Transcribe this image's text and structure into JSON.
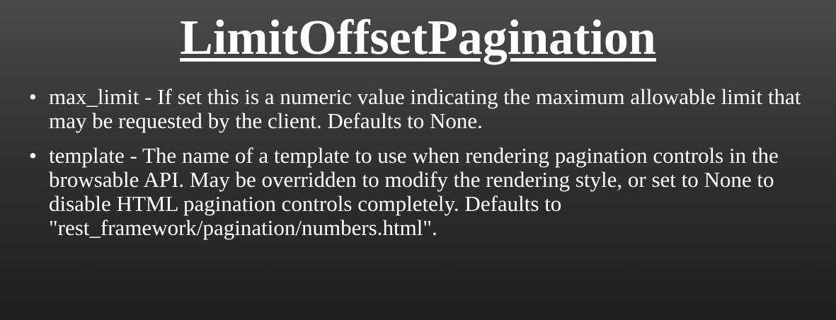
{
  "slide": {
    "title": "LimitOffsetPagination",
    "bullets": [
      {
        "marker": "•",
        "text": "max_limit - If set this is a numeric value indicating the maximum allowable limit that may be requested by the client. Defaults to None."
      },
      {
        "marker": "•",
        "text": "template - The name of a template to use when rendering pagination controls in the browsable API. May be overridden to modify the rendering style, or set to None to disable HTML pagination controls completely. Defaults to \"rest_framework/pagination/numbers.html\"."
      }
    ]
  },
  "colors": {
    "text": "#ffffff",
    "background_top": "#4a4a4a",
    "background_bottom": "#1f1f1f"
  }
}
